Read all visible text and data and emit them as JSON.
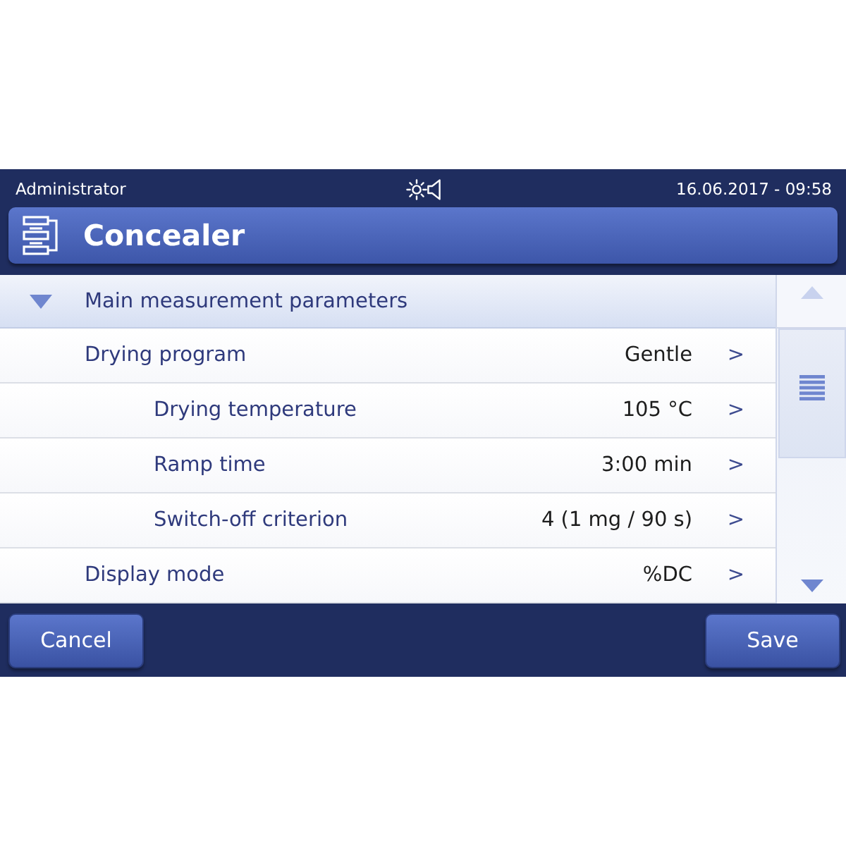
{
  "status_bar": {
    "user": "Administrator",
    "date_time": "16.06.2017 - 09:58"
  },
  "title_bar": {
    "title": "Concealer"
  },
  "section": {
    "label": "Main measurement parameters",
    "expanded": true,
    "items": [
      {
        "label": "Drying program",
        "value": "Gentle",
        "chevron": ">",
        "children": [
          {
            "label": "Drying temperature",
            "value": "105 °C",
            "chevron": ">"
          },
          {
            "label": "Ramp time",
            "value": "3:00 min",
            "chevron": ">"
          },
          {
            "label": "Switch-off criterion",
            "value": "4 (1 mg / 90 s)",
            "chevron": ">"
          }
        ]
      },
      {
        "label": "Display mode",
        "value": "%DC",
        "chevron": ">"
      }
    ]
  },
  "buttons": [
    {
      "label": "Cancel"
    },
    {
      "label": "Save"
    }
  ]
}
